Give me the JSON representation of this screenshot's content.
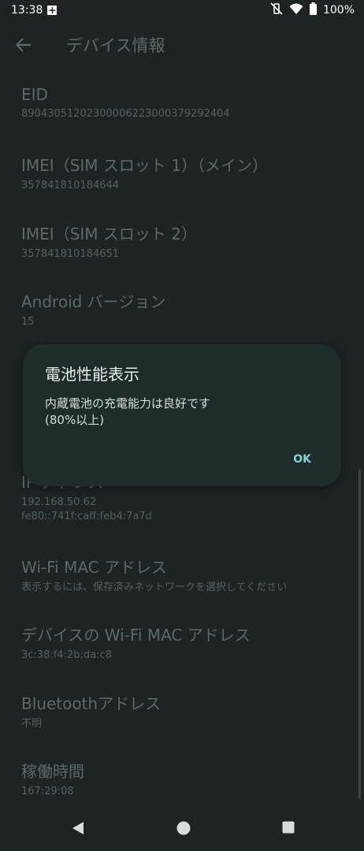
{
  "status_bar": {
    "time": "13:38",
    "battery": "100%"
  },
  "app_bar": {
    "title": "デバイス情報"
  },
  "items": [
    {
      "title": "EID",
      "sub": "89043051202300006223000379292404"
    },
    {
      "title": "IMEI（SIM スロット 1）（メイン）",
      "sub": "357841810184644"
    },
    {
      "title": "IMEI（SIM スロット 2）",
      "sub": "357841810184651"
    },
    {
      "title": "Android バージョン",
      "sub": "15"
    },
    {
      "title": "IP アドレス",
      "sub": "192.168.50.62",
      "sub2": "fe80::741f:caff:feb4:7a7d"
    },
    {
      "title": "Wi-Fi MAC アドレス",
      "sub": "表示するには、保存済みネットワークを選択してください"
    },
    {
      "title": "デバイスの Wi-Fi MAC アドレス",
      "sub": "3c:38:f4:2b:da:c8"
    },
    {
      "title": "Bluetoothアドレス",
      "sub": "不明"
    },
    {
      "title": "稼働時間",
      "sub": "167:29:08"
    }
  ],
  "dialog": {
    "title": "電池性能表示",
    "body_line1": "内蔵電池の充電能力は良好です",
    "body_line2": "(80%以上)",
    "ok_label": "OK"
  },
  "colors": {
    "background": "#1c2424",
    "dialog": "#1e2c2c",
    "accent": "#86d1d1"
  }
}
